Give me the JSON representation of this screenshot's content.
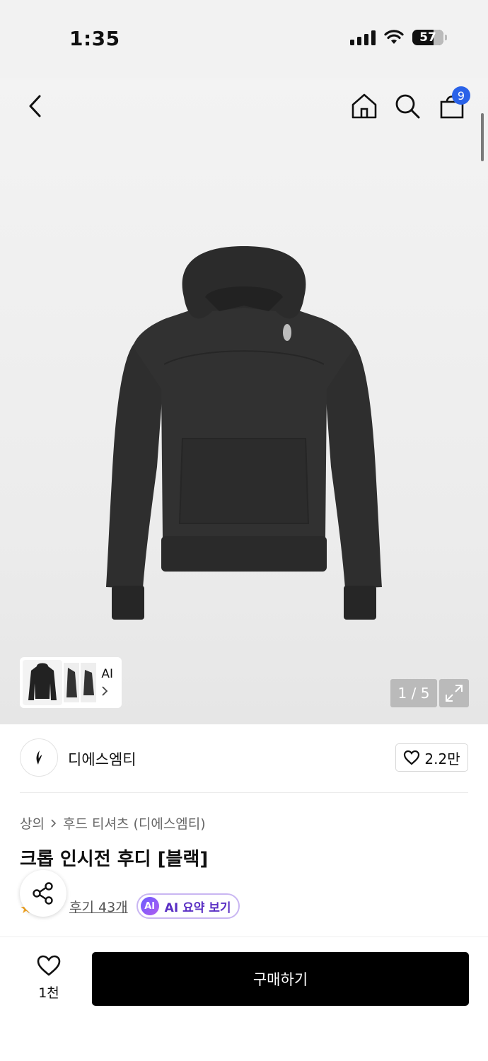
{
  "status_bar": {
    "time": "1:35",
    "battery": "57"
  },
  "nav": {
    "back_icon": "chevron-left-icon",
    "home_icon": "home-icon",
    "search_icon": "search-icon",
    "cart_icon": "shopping-bag-icon",
    "cart_count": "9"
  },
  "gallery": {
    "ai_label": "AI",
    "page_counter": "1 / 5",
    "expand_icon": "expand-icon"
  },
  "brand": {
    "name": "디에스엠티",
    "like_count": "2.2만"
  },
  "product": {
    "breadcrumb": [
      "상의",
      "후드 티셔츠 (디에스엠티)"
    ],
    "title": "크롭 인시전 후디 [블랙]",
    "review_count": "후기 43개",
    "ai_summary_badge": "AI",
    "ai_summary_label": "AI 요약 보기"
  },
  "bottom_bar": {
    "wish_count": "1천",
    "buy_label": "구매하기"
  },
  "colors": {
    "badge": "#2a62e8",
    "buy_button": "#000000",
    "ai_accent": "#5a2fc4"
  }
}
